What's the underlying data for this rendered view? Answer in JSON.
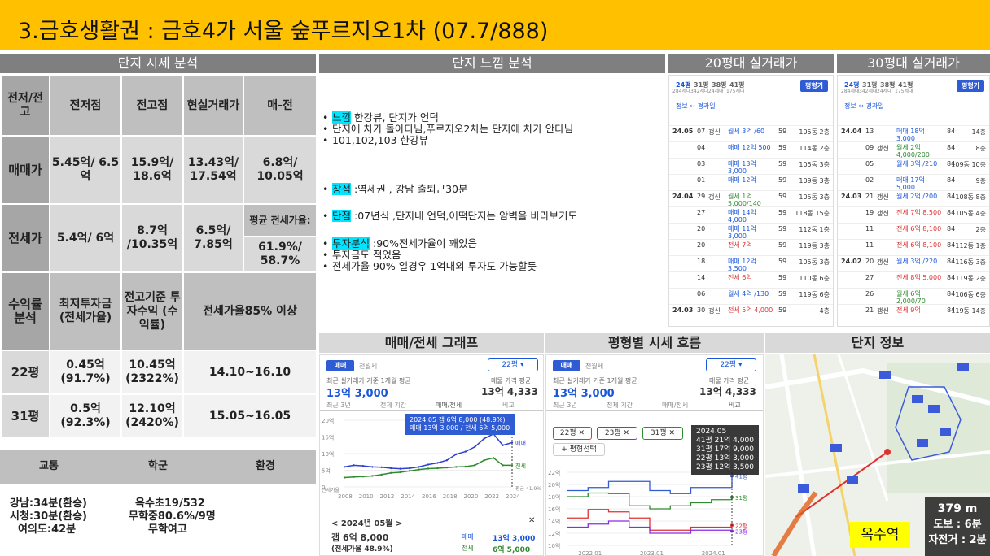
{
  "title": "3.금호생활권 : 금호4가 서울 숲푸르지오1차 (07.7/888)",
  "headers": {
    "analysis": "단지 시세 분석",
    "feel": "단지 느낌 분석",
    "trade20": "20평대 실거래가",
    "trade30": "30평대 실거래가",
    "graph": "매매/전세 그래프",
    "flow": "평형별 시세 흐름",
    "info": "단지 정보"
  },
  "table": {
    "h_jeonjeo": "전저/전고",
    "h_jeonjeojeom": "전저점",
    "h_jeongojeom": "전고점",
    "h_real": "현실거래가",
    "h_diff": "매-전",
    "r1_label": "매매가",
    "r1_jeonjeo": "5.45억/ 6.5억",
    "r1_jeongo": "15.9억/ 18.6억",
    "r1_real": "13.43억/ 17.54억",
    "r1_diff": "6.8억/ 10.05억",
    "r2_label": "전세가",
    "r2_jeonjeo": "5.4억/ 6억",
    "r2_jeongo": "8.7억 /10.35억",
    "r2_real": "6.5억/ 7.85억",
    "r2_ratio_label": "평균 전세가율:",
    "r2_ratio": "61.9%/ 58.7%",
    "r3_label": "수익률 분석",
    "r3_min": "최저투자금 (전세가율)",
    "r3_yield": "전고기준 투자수익 (수익률)",
    "r3_note": "전세가율85% 이상",
    "r4_label": "22평",
    "r4_min": "0.45억 (91.7%)",
    "r4_yield": "10.45억 (2322%)",
    "r4_range": "14.10~16.10",
    "r5_label": "31평",
    "r5_min": "0.5억 (92.3%)",
    "r5_yield": "12.10억 (2420%)",
    "r5_range": "15.05~16.05"
  },
  "bottom": {
    "transport": "교통",
    "school": "학군",
    "env": "환경",
    "t1": "강남:34분(환승)",
    "t2": "시청:30분(환승)",
    "t3": "여의도:42분",
    "s1": "옥수초19/532",
    "s2": "무학중80.6%/9명",
    "s3": "무학여고"
  },
  "feel": {
    "b1_tag": "느낌",
    "b1_text": " 한강뷰, 단지가 언덕",
    "b2": "단지에 차가 돌아다님,푸르지오2차는 단지에 차가 안다님",
    "b3": "101,102,103 한강뷰",
    "b4_tag": "장점",
    "b4_text": " :역세권 , 강남 출퇴근30분",
    "b5_tag": "단점",
    "b5_text": " :07년식 ,단지내 언덕,어떡단지는 암벽을 바라보기도",
    "b6_tag": "투자분석",
    "b6_text": " :90%전세가율이 꽤있음",
    "b7": "투자금도 적었음",
    "b8": "전세가율 90% 일경우 1억내외 투자도 가능할듯"
  },
  "trade20": {
    "tabs": [
      "24평",
      "31평",
      "38평",
      "41평"
    ],
    "tab_sub": [
      "284세대",
      "342세대",
      "24세대",
      "175세대"
    ],
    "btn": "평형기",
    "sub": "정보 ↔ 경과일",
    "rows": [
      {
        "m": "24.05",
        "d": "07",
        "k": "갱신",
        "p": "월세 3억 /60",
        "c": "bl",
        "a": "59",
        "f": "105동 2층"
      },
      {
        "m": "",
        "d": "04",
        "k": "",
        "p": "매매 12억 500",
        "c": "bl",
        "a": "59",
        "f": "114동 2층"
      },
      {
        "m": "",
        "d": "03",
        "k": "",
        "p": "매매 13억 3,000",
        "c": "bl",
        "a": "59",
        "f": "105동 3층"
      },
      {
        "m": "",
        "d": "01",
        "k": "",
        "p": "매매 12억",
        "c": "bl",
        "a": "59",
        "f": "109동 3층"
      },
      {
        "m": "24.04",
        "d": "29",
        "k": "갱신",
        "p": "월세 1억 5,000/140",
        "c": "gr",
        "a": "59",
        "f": "105동 3층"
      },
      {
        "m": "",
        "d": "27",
        "k": "",
        "p": "매매 14억 4,000",
        "c": "bl",
        "a": "59",
        "f": "118동 15층"
      },
      {
        "m": "",
        "d": "20",
        "k": "",
        "p": "매매 11억 3,000",
        "c": "bl",
        "a": "59",
        "f": "112동 1층"
      },
      {
        "m": "",
        "d": "20",
        "k": "",
        "p": "전세 7억",
        "c": "rd",
        "a": "59",
        "f": "119동 3층"
      },
      {
        "m": "",
        "d": "18",
        "k": "",
        "p": "매매 12억 3,500",
        "c": "bl",
        "a": "59",
        "f": "105동 3층"
      },
      {
        "m": "",
        "d": "14",
        "k": "",
        "p": "전세 6억",
        "c": "rd",
        "a": "59",
        "f": "110동 6층"
      },
      {
        "m": "",
        "d": "06",
        "k": "",
        "p": "월세 4억 /130",
        "c": "bl",
        "a": "59",
        "f": "119동 6층"
      },
      {
        "m": "24.03",
        "d": "30",
        "k": "갱신",
        "p": "전세 5억 4,000",
        "c": "rd",
        "a": "59",
        "f": "4층"
      }
    ]
  },
  "trade30": {
    "rows": [
      {
        "m": "24.04",
        "d": "13",
        "k": "",
        "p": "매매 18억 3,000",
        "c": "bl",
        "a": "84",
        "f": "14층"
      },
      {
        "m": "",
        "d": "09",
        "k": "갱신",
        "p": "월세 2억 4,000/200",
        "c": "gr",
        "a": "84",
        "f": "8층"
      },
      {
        "m": "",
        "d": "05",
        "k": "",
        "p": "월세 3억 /210",
        "c": "bl",
        "a": "84",
        "f": "109동 10층"
      },
      {
        "m": "",
        "d": "02",
        "k": "",
        "p": "매매 17억 5,000",
        "c": "bl",
        "a": "84",
        "f": "9층"
      },
      {
        "m": "24.03",
        "d": "21",
        "k": "갱신",
        "p": "월세 2억 /200",
        "c": "bl",
        "a": "84",
        "f": "108동 8층"
      },
      {
        "m": "",
        "d": "19",
        "k": "갱신",
        "p": "전세 7억 8,500",
        "c": "rd",
        "a": "84",
        "f": "105동 4층"
      },
      {
        "m": "",
        "d": "11",
        "k": "",
        "p": "전세 6억 8,100",
        "c": "rd",
        "a": "84",
        "f": "2층"
      },
      {
        "m": "",
        "d": "11",
        "k": "",
        "p": "전세 6억 8,100",
        "c": "rd",
        "a": "84",
        "f": "112동 1층"
      },
      {
        "m": "24.02",
        "d": "20",
        "k": "갱신",
        "p": "월세 3억 /220",
        "c": "bl",
        "a": "84",
        "f": "116동 3층"
      },
      {
        "m": "",
        "d": "27",
        "k": "",
        "p": "전세 8억 5,000",
        "c": "rd",
        "a": "84",
        "f": "119동 2층"
      },
      {
        "m": "",
        "d": "26",
        "k": "",
        "p": "월세 6억 2,000/70",
        "c": "gr",
        "a": "84",
        "f": "106동 6층"
      },
      {
        "m": "",
        "d": "21",
        "k": "갱신",
        "p": "전세 9억",
        "c": "rd",
        "a": "84",
        "f": "119동 14층"
      }
    ]
  },
  "graph": {
    "tab1": "매매",
    "tab2": "전월세",
    "select": "22평 ▾",
    "subtitle": "최근 실거래가 기준 1개월 평균",
    "price": "13억 3,000",
    "sale_avg_label": "매물 가격 평균",
    "sale_avg": "13억 4,333",
    "periods": [
      "최근 3년",
      "전체 기간",
      "매매/전세",
      "비교"
    ],
    "tooltip1": "2024.05  갭 6억 8,000 (48.9%)",
    "tooltip2": "매매 13억 3,000 / 전세 6억 5,000",
    "yticks": [
      "20억",
      "15억",
      "10억",
      "5억",
      "0"
    ],
    "ylabel": "전세가율",
    "xticks": [
      "2008",
      "2010",
      "2012",
      "2014",
      "2016",
      "2018",
      "2020",
      "2022",
      "2024"
    ],
    "legend_sale": "매매",
    "legend_jeonse": "전세",
    "legend_rate": "평균 41.9%",
    "nav": "< 2024년 05월 >",
    "close": "✕",
    "gap": "갭 6억 8,000",
    "rate": "(전세가율 48.9%)",
    "sale_label": "매매",
    "sale_val": "13억 3,000",
    "jeonse_label": "전세",
    "jeonse_val": "6억 5,000"
  },
  "flow": {
    "tab1": "매매",
    "tab2": "전월세",
    "select": "22평 ▾",
    "subtitle": "최근 실거래가 기준 1개월 평균",
    "price": "13억 3,000",
    "sale_avg_label": "매물 가격 평균",
    "sale_avg": "13억 4,333",
    "periods": [
      "최근 3년",
      "전체 기간",
      "매매/전세",
      "비교"
    ],
    "tags": [
      "22평 ✕",
      "23평 ✕",
      "31평 ✕"
    ],
    "add": "+ 평형선택",
    "tip_title": "2024.05",
    "tip_rows": [
      "41평 21억 4,000",
      "31평 17억 9,000",
      "22평 13억 3,000",
      "23평 12억 3,500"
    ],
    "yticks": [
      "22억",
      "20억",
      "18억",
      "16억",
      "14억",
      "12억",
      "10억"
    ],
    "xticks": [
      "2022.01",
      "2023.01",
      "2024.01"
    ],
    "labels": [
      "41평",
      "31평",
      "22평",
      "23평"
    ]
  },
  "info": {
    "distance": "379 m",
    "walk": "도보 : 6분",
    "bike": "자전거 : 2분",
    "station": "옥수역"
  },
  "chart_data": [
    {
      "type": "line",
      "x": [
        2006,
        2007,
        2008,
        2009,
        2010,
        2011,
        2012,
        2013,
        2014,
        2015,
        2016,
        2017,
        2018,
        2019,
        2020,
        2021,
        2022,
        2023,
        2024
      ],
      "series": [
        {
          "name": "매매",
          "values": [
            6.0,
            6.5,
            6.3,
            6.0,
            5.9,
            5.6,
            5.45,
            5.6,
            6.0,
            6.7,
            7.2,
            8.0,
            9.8,
            10.6,
            12.0,
            14.5,
            15.9,
            12.5,
            13.3
          ]
        },
        {
          "name": "전세",
          "values": [
            2.8,
            3.0,
            3.1,
            3.3,
            3.7,
            4.2,
            4.4,
            4.8,
            5.2,
            5.5,
            5.6,
            5.8,
            6.0,
            6.1,
            6.5,
            8.0,
            8.7,
            6.5,
            6.5
          ]
        }
      ],
      "ylim": [
        0,
        20
      ],
      "legend": "right"
    },
    {
      "type": "line",
      "x": [
        "2021.09",
        "2022.01",
        "2022.05",
        "2022.09",
        "2023.01",
        "2023.05",
        "2023.09",
        "2024.01",
        "2024.05"
      ],
      "series": [
        {
          "name": "41평",
          "values": [
            19.0,
            19.5,
            20.5,
            20.5,
            19.0,
            18.5,
            19.5,
            19.5,
            21.4
          ]
        },
        {
          "name": "31평",
          "values": [
            18.0,
            18.6,
            18.5,
            16.5,
            16.0,
            16.5,
            17.0,
            17.5,
            17.9
          ]
        },
        {
          "name": "22평",
          "values": [
            14.5,
            15.9,
            15.5,
            14.5,
            12.5,
            12.5,
            13.0,
            13.0,
            13.3
          ]
        },
        {
          "name": "23평",
          "values": [
            13.0,
            13.5,
            14.0,
            13.0,
            12.0,
            12.0,
            12.5,
            12.5,
            12.35
          ]
        }
      ],
      "ylim": [
        10,
        22
      ],
      "legend": "right"
    }
  ]
}
